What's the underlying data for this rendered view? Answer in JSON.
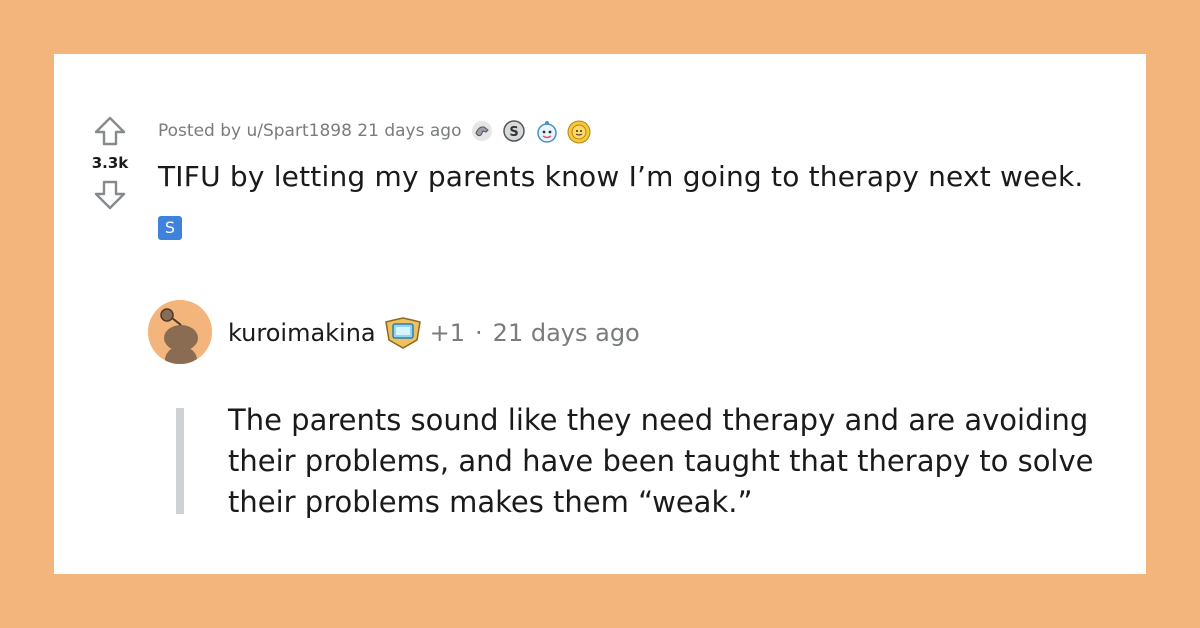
{
  "post": {
    "vote_count": "3.3k",
    "posted_by": "Posted by u/Spart1898 21 days ago",
    "awards": [
      "silver-hand-award-icon",
      "s-coin-award-icon",
      "wholesome-seal-award-icon",
      "gold-sun-award-icon"
    ],
    "title": "TIFU by letting my parents know I’m going to therapy next week.",
    "flair": "S"
  },
  "comment": {
    "username": "kuroimakina",
    "score": "+1",
    "separator": "·",
    "time": "21 days ago",
    "body": "The parents sound like they need therapy and are avoiding their problems, and have been taught that therapy to solve their problems makes them “weak.”"
  },
  "colors": {
    "background": "#f4b57c",
    "card": "#ffffff",
    "text": "#1a1a1b",
    "meta": "#787c7e",
    "flair": "#3f82dc",
    "thread_line": "#cfd2d4"
  }
}
